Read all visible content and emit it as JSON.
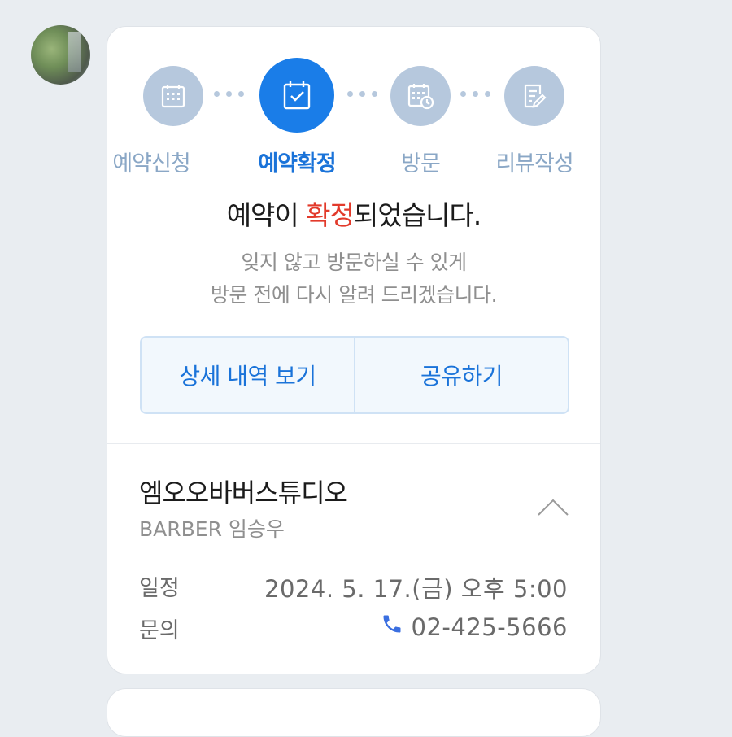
{
  "steps": [
    {
      "label": "예약신청",
      "icon": "calendar-icon",
      "active": false
    },
    {
      "label": "예약확정",
      "icon": "calendar-check-icon",
      "active": true
    },
    {
      "label": "방문",
      "icon": "calendar-clock-icon",
      "active": false
    },
    {
      "label": "리뷰작성",
      "icon": "edit-note-icon",
      "active": false
    }
  ],
  "status": {
    "title_before": "예약이 ",
    "title_highlight": "확정",
    "title_after": "되었습니다.",
    "desc_line1": "잊지 않고 방문하실 수 있게",
    "desc_line2": "방문 전에 다시 알려 드리겠습니다."
  },
  "actions": {
    "details_label": "상세 내역 보기",
    "share_label": "공유하기"
  },
  "shop": {
    "name": "엠오오바버스튜디오",
    "designer": "BARBER 임승우"
  },
  "info": {
    "schedule_label": "일정",
    "schedule_value": "2024. 5. 17.(금) 오후 5:00",
    "contact_label": "문의",
    "contact_value": "02-425-5666"
  },
  "colors": {
    "accent": "#1a7de8",
    "inactive": "#b6c8dd",
    "highlight": "#e23a2b"
  }
}
